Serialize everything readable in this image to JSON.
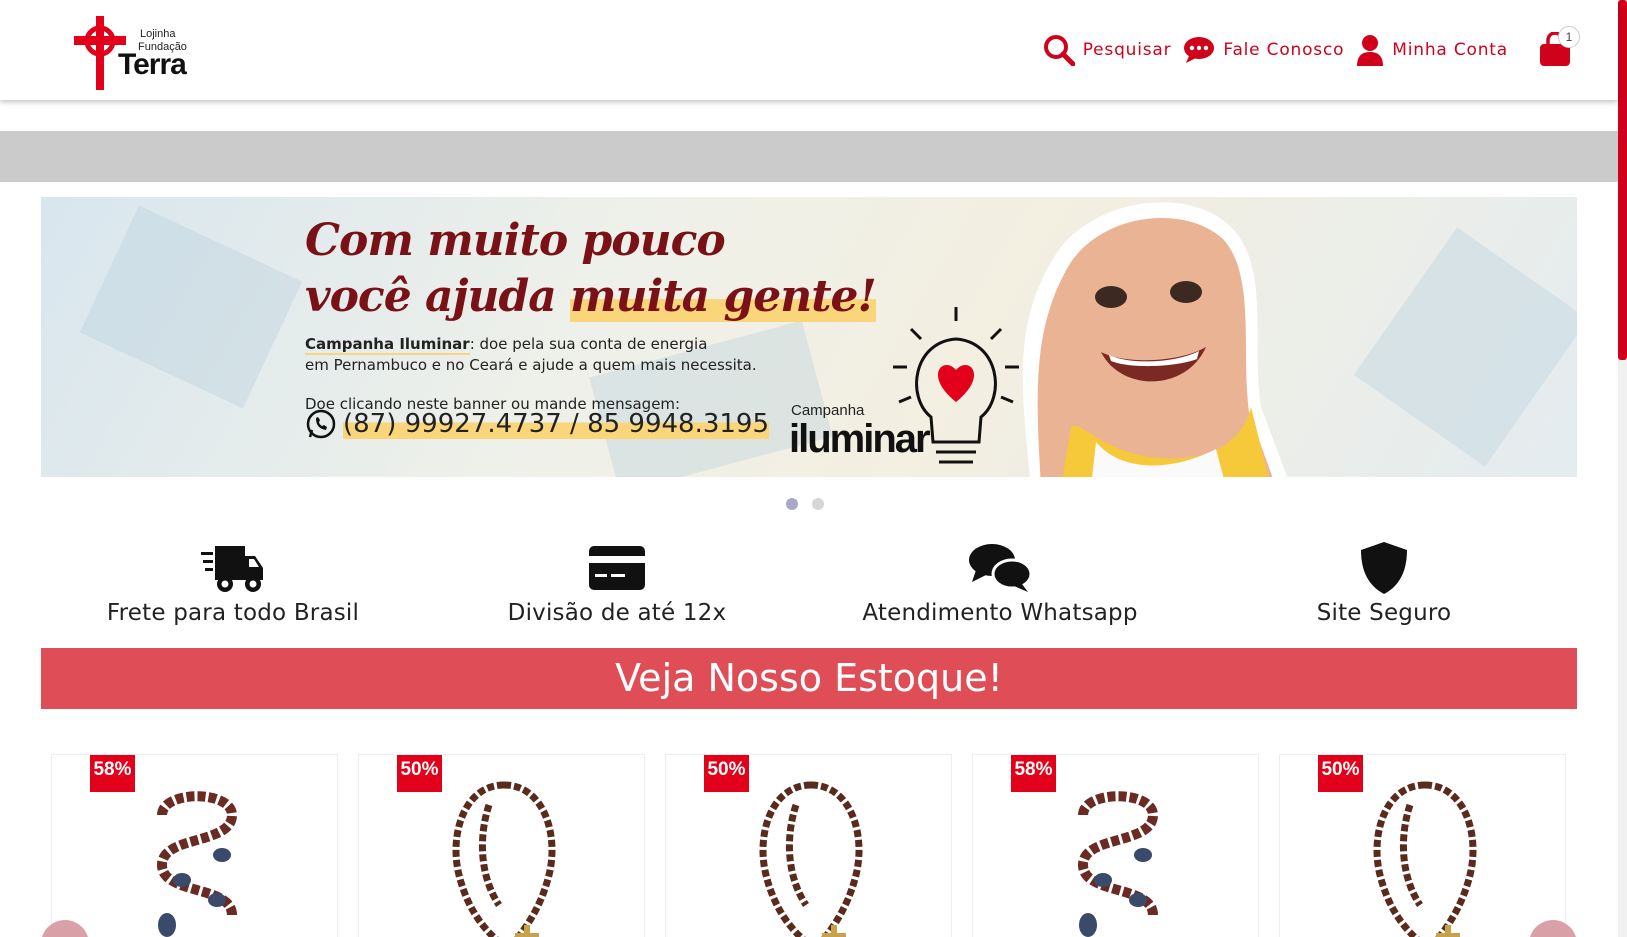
{
  "logo": {
    "line1": "Lojinha",
    "line2": "Fundação",
    "line3": "Terra"
  },
  "nav": {
    "search": "Pesquisar",
    "contact": "Fale Conosco",
    "account": "Minha Conta",
    "cart_count": "1"
  },
  "banner": {
    "headline1": "Com muito pouco",
    "headline2a": "você ajuda ",
    "headline2b": "muita gente!",
    "text1_bold": "Campanha Iluminar",
    "text1_rest": ": doe pela sua conta de energia",
    "text2": "em Pernambuco e no Ceará e ajude a quem mais necessita.",
    "text3": "Doe clicando neste banner ou mande mensagem:",
    "phone": "(87) 99927.4737 / 85 9948.3195",
    "campaign_small": "Campanha",
    "campaign_big": "iluminar"
  },
  "features": [
    {
      "label": "Frete para todo Brasil",
      "icon": "truck-icon"
    },
    {
      "label": "Divisão de até 12x",
      "icon": "credit-card-icon"
    },
    {
      "label": "Atendimento Whatsapp",
      "icon": "chat-icon"
    },
    {
      "label": "Site Seguro",
      "icon": "shield-icon"
    }
  ],
  "stock_title": "Veja Nosso Estoque!",
  "products": [
    {
      "discount": "58%"
    },
    {
      "discount": "50%"
    },
    {
      "discount": "50%"
    },
    {
      "discount": "58%"
    },
    {
      "discount": "50%"
    }
  ],
  "colors": {
    "brand_red": "#d0021b",
    "stock_bar": "#df4e56",
    "badge": "#e2001a"
  }
}
